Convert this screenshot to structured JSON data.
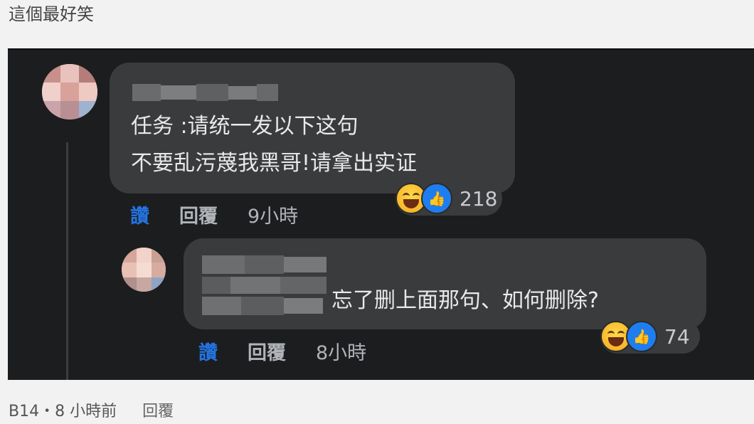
{
  "post": {
    "text": "這個最好笑"
  },
  "comments": [
    {
      "line1": "任务 :请统一发以下这句",
      "line2": "不要乱污蔑我黑哥!请拿出实证",
      "reaction_count": "218",
      "like_label": "讚",
      "reply_label": "回覆",
      "time": "9小時"
    },
    {
      "text": "忘了删上面那句、如何删除?",
      "reaction_count": "74",
      "like_label": "讚",
      "reply_label": "回覆",
      "time": "8小時"
    }
  ],
  "footer": {
    "meta": "B14・8 小時前",
    "reply_label": "回覆"
  },
  "icons": [
    "haha-icon",
    "like-icon"
  ],
  "colors": {
    "page_bg": "#f2f2f2",
    "dark_bg": "#1c1d1f",
    "bubble_bg": "#3a3b3d",
    "like_blue": "#2374e1"
  }
}
